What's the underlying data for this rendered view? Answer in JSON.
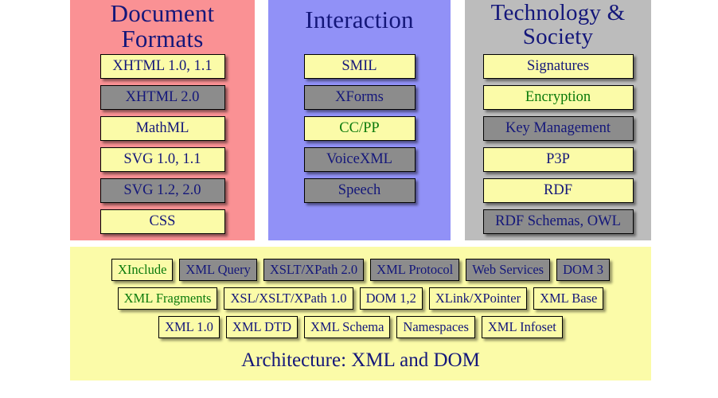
{
  "diagram": {
    "title": "Architecture: XML and DOM",
    "colors": {
      "column_pink": "#fa9194",
      "column_blue": "#9191f7",
      "column_gray": "#bcbcbc",
      "box_yellow": "#fbfba8",
      "box_gray": "#8c8c8c",
      "text_navy": "#14177a",
      "text_green": "#0b7a0b",
      "panel_yellow": "#fbfba8"
    }
  },
  "columns": [
    {
      "id": "document-formats",
      "title": "Document Formats",
      "background": "#fa9194",
      "items": [
        {
          "label": "XHTML 1.0, 1.1",
          "fill": "yellow",
          "text_color": "navy"
        },
        {
          "label": "XHTML 2.0",
          "fill": "gray",
          "text_color": "navy"
        },
        {
          "label": "MathML",
          "fill": "yellow",
          "text_color": "navy"
        },
        {
          "label": "SVG 1.0, 1.1",
          "fill": "yellow",
          "text_color": "navy"
        },
        {
          "label": "SVG 1.2, 2.0",
          "fill": "gray",
          "text_color": "navy"
        },
        {
          "label": "CSS",
          "fill": "yellow",
          "text_color": "navy"
        }
      ]
    },
    {
      "id": "interaction",
      "title": "Interaction",
      "background": "#9191f7",
      "items": [
        {
          "label": "SMIL",
          "fill": "yellow",
          "text_color": "navy"
        },
        {
          "label": "XForms",
          "fill": "gray",
          "text_color": "navy"
        },
        {
          "label": "CC/PP",
          "fill": "yellow",
          "text_color": "green"
        },
        {
          "label": "VoiceXML",
          "fill": "gray",
          "text_color": "navy"
        },
        {
          "label": "Speech",
          "fill": "gray",
          "text_color": "navy"
        }
      ]
    },
    {
      "id": "technology-and-society",
      "title": "Technology & Society",
      "background": "#bcbcbc",
      "items": [
        {
          "label": "Signatures",
          "fill": "yellow",
          "text_color": "navy"
        },
        {
          "label": "Encryption",
          "fill": "yellow",
          "text_color": "green"
        },
        {
          "label": "Key Management",
          "fill": "gray",
          "text_color": "navy"
        },
        {
          "label": "P3P",
          "fill": "yellow",
          "text_color": "navy"
        },
        {
          "label": "RDF",
          "fill": "yellow",
          "text_color": "navy"
        },
        {
          "label": "RDF Schemas, OWL",
          "fill": "gray",
          "text_color": "navy"
        }
      ]
    }
  ],
  "bottom_panel": {
    "caption": "Architecture: XML and DOM",
    "background": "#fbfba8",
    "rows": [
      [
        {
          "label": "XInclude",
          "fill": "yellow",
          "text_color": "green"
        },
        {
          "label": "XML Query",
          "fill": "gray",
          "text_color": "navy"
        },
        {
          "label": "XSLT/XPath 2.0",
          "fill": "gray",
          "text_color": "navy"
        },
        {
          "label": "XML Protocol",
          "fill": "gray",
          "text_color": "navy"
        },
        {
          "label": "Web Services",
          "fill": "gray",
          "text_color": "navy"
        },
        {
          "label": "DOM 3",
          "fill": "gray",
          "text_color": "navy"
        }
      ],
      [
        {
          "label": "XML Fragments",
          "fill": "yellow",
          "text_color": "green"
        },
        {
          "label": "XSL/XSLT/XPath 1.0",
          "fill": "yellow",
          "text_color": "navy"
        },
        {
          "label": "DOM 1,2",
          "fill": "yellow",
          "text_color": "navy"
        },
        {
          "label": "XLink/XPointer",
          "fill": "yellow",
          "text_color": "navy"
        },
        {
          "label": "XML Base",
          "fill": "yellow",
          "text_color": "navy"
        }
      ],
      [
        {
          "label": "XML 1.0",
          "fill": "yellow",
          "text_color": "navy"
        },
        {
          "label": "XML DTD",
          "fill": "yellow",
          "text_color": "navy"
        },
        {
          "label": "XML Schema",
          "fill": "yellow",
          "text_color": "navy"
        },
        {
          "label": "Namespaces",
          "fill": "yellow",
          "text_color": "navy"
        },
        {
          "label": "XML Infoset",
          "fill": "yellow",
          "text_color": "navy"
        }
      ]
    ]
  }
}
